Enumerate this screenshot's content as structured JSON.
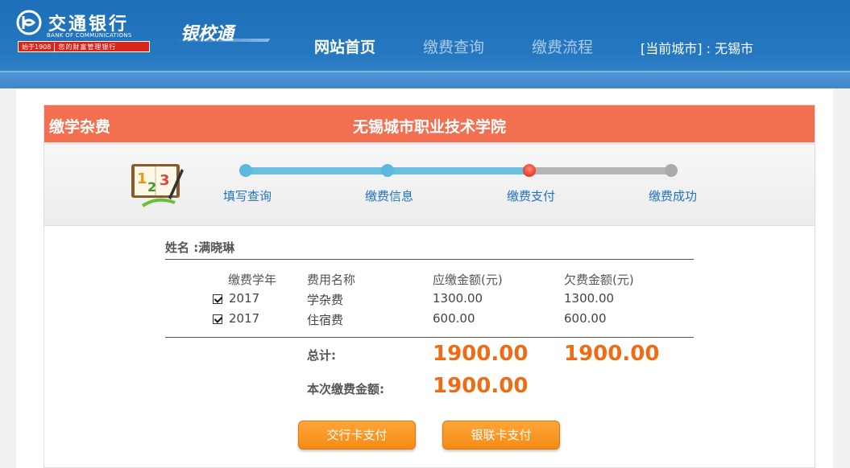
{
  "header": {
    "logo": {
      "name_cn": "交通银行",
      "name_en": "BANK OF COMMUNICATIONS",
      "since": "始于1908",
      "slogan": "您的财富管理银行"
    },
    "product_name": "银校通",
    "nav": {
      "home": "网站首页",
      "query": "缴费查询",
      "flow": "缴费流程",
      "city_label": "[当前城市] :",
      "city_value": "无锡市"
    },
    "colors": {
      "header_blue": "#1d6fb8",
      "nav_inactive": "#a9cbea"
    }
  },
  "panel": {
    "section_title": "缴学杂费",
    "school_name": "无锡城市职业技术学院",
    "title_color": "#f26f4f"
  },
  "steps": {
    "items": [
      {
        "label": "填写查询",
        "state": "done"
      },
      {
        "label": "缴费信息",
        "state": "done"
      },
      {
        "label": "缴费支付",
        "state": "current"
      },
      {
        "label": "缴费成功",
        "state": "pending"
      }
    ],
    "icon": "book-123-pencil-icon"
  },
  "payer": {
    "name_label": "姓名 :",
    "name_value": "满晓琳"
  },
  "fees": {
    "columns": [
      "缴费学年",
      "费用名称",
      "应缴金额(元)",
      "欠费金额(元)"
    ],
    "rows": [
      {
        "checked": true,
        "year": "2017",
        "item": "学杂费",
        "due": "1300.00",
        "owed": "1300.00"
      },
      {
        "checked": true,
        "year": "2017",
        "item": "住宿费",
        "due": "600.00",
        "owed": "600.00"
      }
    ],
    "total_label": "总计:",
    "total_due": "1900.00",
    "total_owed": "1900.00",
    "pay_now_label": "本次缴费金额:",
    "pay_now_amount": "1900.00",
    "amount_color": "#f06b15"
  },
  "actions": {
    "bocom_card": "交行卡支付",
    "unionpay_card": "银联卡支付"
  }
}
